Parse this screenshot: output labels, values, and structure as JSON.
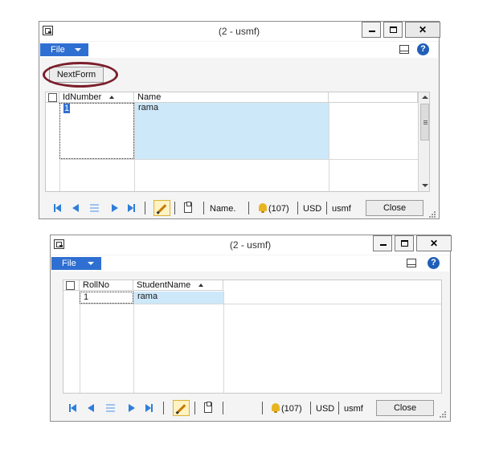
{
  "window1": {
    "title": "(2 - usmf)",
    "file_menu": "File",
    "toolbar_button": "NextForm",
    "columns": [
      "IdNumber",
      "Name"
    ],
    "rows": [
      {
        "id": "1",
        "name": "rama"
      }
    ],
    "status": {
      "name_field": "Name.",
      "notifications": "(107)",
      "currency": "USD",
      "company": "usmf",
      "close_label": "Close"
    }
  },
  "window2": {
    "title": "(2 - usmf)",
    "file_menu": "File",
    "columns": [
      "RollNo",
      "StudentName"
    ],
    "rows": [
      {
        "id": "1",
        "name": "rama"
      }
    ],
    "status": {
      "notifications": "(107)",
      "currency": "USD",
      "company": "usmf",
      "close_label": "Close"
    }
  },
  "colors": {
    "accent": "#2f6fd2",
    "selection": "#cde8f9",
    "highlight_ring": "#7a1f2b",
    "nav_arrow": "#2f7ed8"
  },
  "icons": [
    "app-icon",
    "minimize-icon",
    "maximize-icon",
    "close-icon",
    "caret-down-icon",
    "layout-icon",
    "help-icon",
    "sort-ascending-icon",
    "first-record-icon",
    "previous-record-icon",
    "list-view-icon",
    "next-record-icon",
    "last-record-icon",
    "edit-pencil-icon",
    "attachment-icon",
    "notification-bell-icon",
    "resize-grip-icon"
  ]
}
